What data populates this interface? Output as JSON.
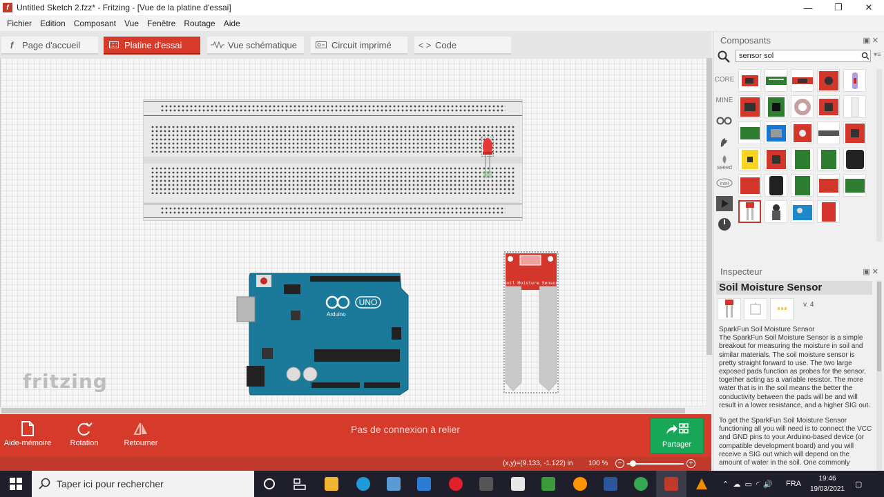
{
  "window": {
    "title": "Untitled Sketch 2.fzz* - Fritzing - [Vue de la platine d'essai]",
    "minimize": "—",
    "maximize": "❐",
    "close": "✕"
  },
  "menu": [
    "Fichier",
    "Edition",
    "Composant",
    "Vue",
    "Fenêtre",
    "Routage",
    "Aide"
  ],
  "tabs": [
    {
      "label": "Page d'accueil",
      "icon": "f-icon"
    },
    {
      "label": "Platine d'essai",
      "icon": "breadboard-icon",
      "active": true
    },
    {
      "label": "Vue schématique",
      "icon": "schematic-icon"
    },
    {
      "label": "Circuit imprimé",
      "icon": "pcb-icon"
    },
    {
      "label": "Code",
      "icon": "code-icon"
    }
  ],
  "canvas": {
    "logo": "fritzing",
    "arduino_label": "UNO",
    "arduino_brand": "Arduino",
    "sensor_label": "Soil Moisture Sensor"
  },
  "toolbar": {
    "notes": "Aide-mémoire",
    "rotate": "Rotation",
    "flip": "Retourner",
    "status": "Pas de connexion à relier",
    "share": "Partager"
  },
  "statusbar": {
    "coords": "(x,y)=(9.133, -1.122) in",
    "zoom": "100 %"
  },
  "components": {
    "title": "Composants",
    "search_value": "sensor sol",
    "bins": [
      "CORE",
      "MINE"
    ]
  },
  "inspector": {
    "title": "Inspecteur",
    "part_name": "Soil Moisture Sensor",
    "version": "v. 4",
    "desc_title": "SparkFun Soil Moisture Sensor",
    "desc_1": "The SparkFun Soil Moisture Sensor is a simple breakout for measuring the moisture in soil and similar materials. The soil moisture sensor is pretty straight forward to use. The two large exposed pads function as probes for the sensor, together acting as a variable resistor. The more water that is in the soil means the better the conductivity between the pads will be and will result in a lower resistance, and a higher SIG out.",
    "desc_2": "To get the SparkFun Soil Moisture Sensor functioning all you will need is to connect the VCC and GND pins to your Arduino-based device (or compatible development board) and you will receive a SIG out which will depend on the amount of water in the soil. One commonly"
  },
  "taskbar": {
    "search_placeholder": "Taper ici pour rechercher",
    "lang": "FRA",
    "time": "19:46",
    "date": "19/03/2021"
  },
  "colors": {
    "accent": "#d63a2b",
    "share": "#18a658",
    "arduino": "#1b7a99",
    "sensor": "#d3362a"
  }
}
